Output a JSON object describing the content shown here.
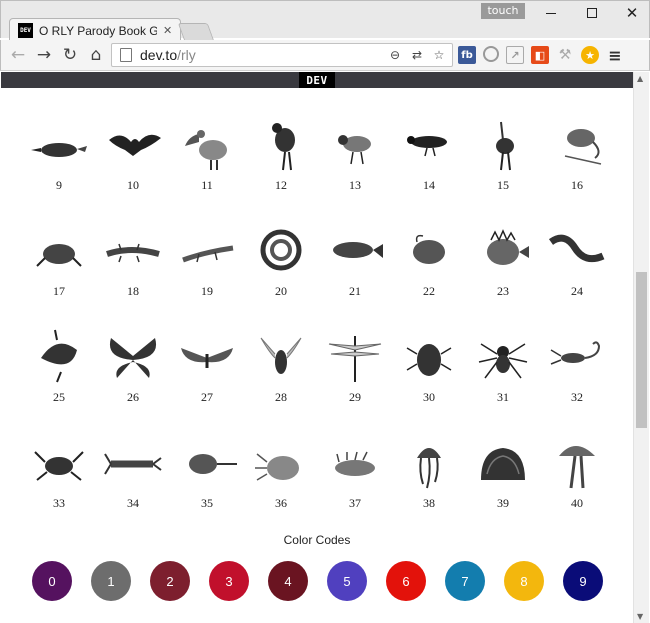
{
  "window": {
    "touch_label": "touch",
    "tab_title": "O RLY Parody Book Gene",
    "tab_favicon_text": "DEV",
    "url_host": "dev.to",
    "url_path": "/rly",
    "extensions": [
      "fb"
    ]
  },
  "site": {
    "logo_text": "DEV"
  },
  "animals": [
    {
      "num": "9",
      "icon": "platypus-icon"
    },
    {
      "num": "10",
      "icon": "bat-icon"
    },
    {
      "num": "11",
      "icon": "pelican-icon"
    },
    {
      "num": "12",
      "icon": "heron-icon"
    },
    {
      "num": "13",
      "icon": "plover-icon"
    },
    {
      "num": "14",
      "icon": "crow-icon"
    },
    {
      "num": "15",
      "icon": "ostrich-icon"
    },
    {
      "num": "16",
      "icon": "chameleon-icon"
    },
    {
      "num": "17",
      "icon": "frog-icon"
    },
    {
      "num": "18",
      "icon": "salamander-icon"
    },
    {
      "num": "19",
      "icon": "lizard-icon"
    },
    {
      "num": "20",
      "icon": "coiled-snake-icon"
    },
    {
      "num": "21",
      "icon": "catfish-icon"
    },
    {
      "num": "22",
      "icon": "anglerfish-icon"
    },
    {
      "num": "23",
      "icon": "spiny-fish-icon"
    },
    {
      "num": "24",
      "icon": "eel-icon"
    },
    {
      "num": "25",
      "icon": "sunfish-icon"
    },
    {
      "num": "26",
      "icon": "butterfly-icon"
    },
    {
      "num": "27",
      "icon": "moth-icon"
    },
    {
      "num": "28",
      "icon": "fly-icon"
    },
    {
      "num": "29",
      "icon": "dragonfly-icon"
    },
    {
      "num": "30",
      "icon": "beetle-icon"
    },
    {
      "num": "31",
      "icon": "spider-icon"
    },
    {
      "num": "32",
      "icon": "scorpion-icon"
    },
    {
      "num": "33",
      "icon": "crab-icon"
    },
    {
      "num": "34",
      "icon": "lobster-icon"
    },
    {
      "num": "35",
      "icon": "horseshoe-crab-icon"
    },
    {
      "num": "36",
      "icon": "sea-anemone-icon"
    },
    {
      "num": "37",
      "icon": "sea-slug-icon"
    },
    {
      "num": "38",
      "icon": "jellyfish-icon"
    },
    {
      "num": "39",
      "icon": "coral-icon"
    },
    {
      "num": "40",
      "icon": "mushroom-icon"
    }
  ],
  "color_codes": {
    "title": "Color Codes",
    "swatches": [
      {
        "label": "0",
        "color": "#55125f"
      },
      {
        "label": "1",
        "color": "#6d6d6d"
      },
      {
        "label": "2",
        "color": "#7d1f2e"
      },
      {
        "label": "3",
        "color": "#c1102c"
      },
      {
        "label": "4",
        "color": "#6a1421"
      },
      {
        "label": "5",
        "color": "#5040bf"
      },
      {
        "label": "6",
        "color": "#e3120b"
      },
      {
        "label": "7",
        "color": "#137dae"
      },
      {
        "label": "8",
        "color": "#f3b70d"
      },
      {
        "label": "9",
        "color": "#0a0c78"
      }
    ]
  }
}
